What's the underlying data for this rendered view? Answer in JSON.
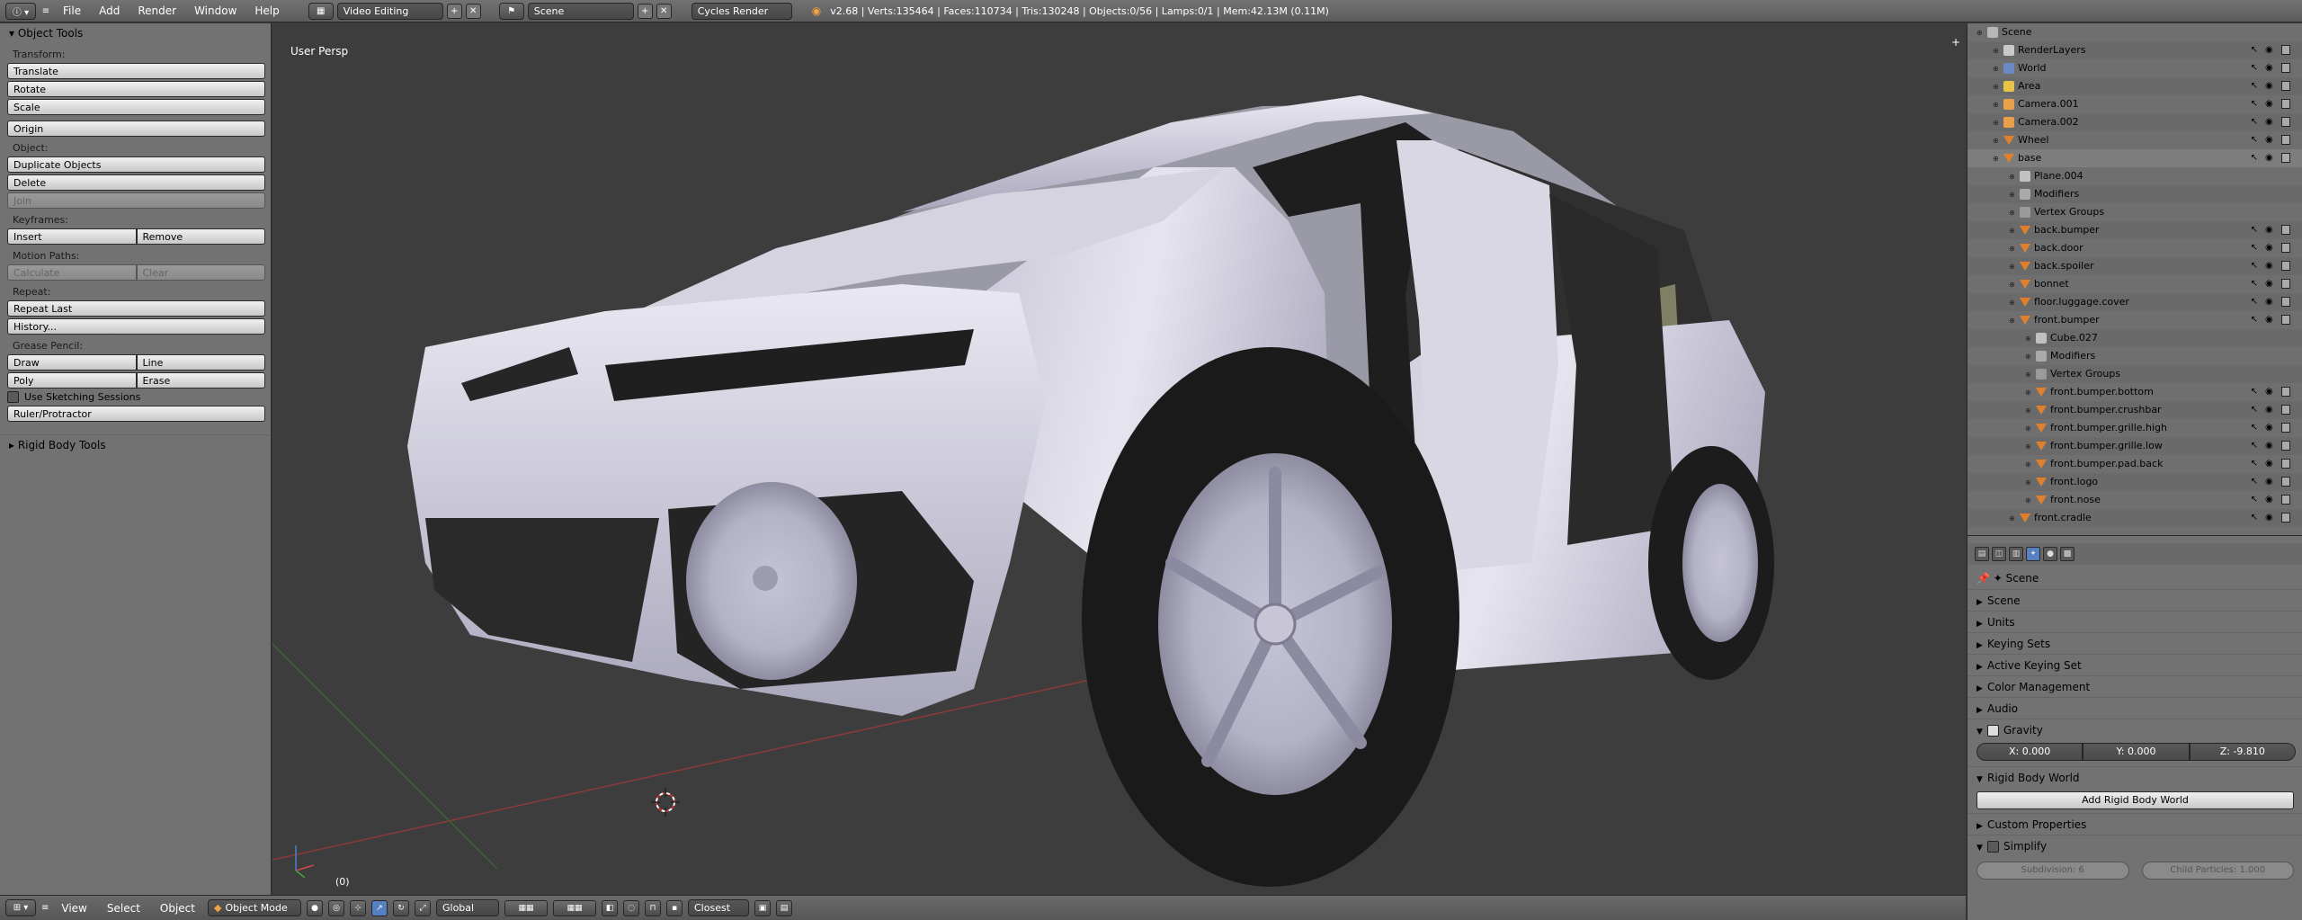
{
  "topbar": {
    "menus": [
      "File",
      "Add",
      "Render",
      "Window",
      "Help"
    ],
    "screen_layout": "Video Editing",
    "scene": "Scene",
    "render_engine": "Cycles Render",
    "stats": "v2.68 | Verts:135464 | Faces:110734 | Tris:130248 | Objects:0/56 | Lamps:0/1 | Mem:42.13M (0.11M)"
  },
  "tools": {
    "panel_title": "Object Tools",
    "transform_label": "Transform:",
    "translate": "Translate",
    "rotate": "Rotate",
    "scale": "Scale",
    "origin": "Origin",
    "object_label": "Object:",
    "duplicate": "Duplicate Objects",
    "delete": "Delete",
    "join": "Join",
    "keyframes_label": "Keyframes:",
    "insert": "Insert",
    "remove": "Remove",
    "motion_paths_label": "Motion Paths:",
    "calculate": "Calculate",
    "clear": "Clear",
    "repeat_label": "Repeat:",
    "repeat_last": "Repeat Last",
    "history": "History...",
    "grease_label": "Grease Pencil:",
    "draw": "Draw",
    "line": "Line",
    "poly": "Poly",
    "erase": "Erase",
    "sketching": "Use Sketching Sessions",
    "ruler": "Ruler/Protractor",
    "rigid_body_tools": "Rigid Body Tools"
  },
  "viewport": {
    "label": "User Persp",
    "frame": "(0)"
  },
  "outliner": {
    "rows": [
      {
        "label": "Scene",
        "indent": 0,
        "icon": "scene-icon"
      },
      {
        "label": "RenderLayers",
        "indent": 1,
        "icon": "renderlayers-icon"
      },
      {
        "label": "World",
        "indent": 1,
        "icon": "world-icon"
      },
      {
        "label": "Area",
        "indent": 1,
        "icon": "lamp-icon"
      },
      {
        "label": "Camera.001",
        "indent": 1,
        "icon": "camera-icon"
      },
      {
        "label": "Camera.002",
        "indent": 1,
        "icon": "camera-icon"
      },
      {
        "label": "Wheel",
        "indent": 1,
        "icon": "mesh-icon"
      },
      {
        "label": "base",
        "indent": 1,
        "icon": "mesh-icon"
      },
      {
        "label": "Plane.004",
        "indent": 2,
        "icon": "mesh-data-icon"
      },
      {
        "label": "Modifiers",
        "indent": 2,
        "icon": "wrench-icon"
      },
      {
        "label": "Vertex Groups",
        "indent": 2,
        "icon": "vertex-groups-icon"
      },
      {
        "label": "back.bumper",
        "indent": 2,
        "icon": "mesh-icon"
      },
      {
        "label": "back.door",
        "indent": 2,
        "icon": "mesh-icon"
      },
      {
        "label": "back.spoiler",
        "indent": 2,
        "icon": "mesh-icon"
      },
      {
        "label": "bonnet",
        "indent": 2,
        "icon": "mesh-icon"
      },
      {
        "label": "floor.luggage.cover",
        "indent": 2,
        "icon": "mesh-icon"
      },
      {
        "label": "front.bumper",
        "indent": 2,
        "icon": "mesh-icon"
      },
      {
        "label": "Cube.027",
        "indent": 3,
        "icon": "mesh-data-icon"
      },
      {
        "label": "Modifiers",
        "indent": 3,
        "icon": "wrench-icon"
      },
      {
        "label": "Vertex Groups",
        "indent": 3,
        "icon": "vertex-groups-icon"
      },
      {
        "label": "front.bumper.bottom",
        "indent": 3,
        "icon": "mesh-icon"
      },
      {
        "label": "front.bumper.crushbar",
        "indent": 3,
        "icon": "mesh-icon"
      },
      {
        "label": "front.bumper.grille.high",
        "indent": 3,
        "icon": "mesh-icon"
      },
      {
        "label": "front.bumper.grille.low",
        "indent": 3,
        "icon": "mesh-icon"
      },
      {
        "label": "front.bumper.pad.back",
        "indent": 3,
        "icon": "mesh-icon"
      },
      {
        "label": "front.logo",
        "indent": 3,
        "icon": "mesh-icon"
      },
      {
        "label": "front.nose",
        "indent": 3,
        "icon": "mesh-icon"
      },
      {
        "label": "front.cradle",
        "indent": 2,
        "icon": "mesh-icon"
      }
    ]
  },
  "properties": {
    "context": "Scene",
    "panels": {
      "scene": "Scene",
      "units": "Units",
      "keying_sets": "Keying Sets",
      "active_keying_set": "Active Keying Set",
      "color_management": "Color Management",
      "audio": "Audio",
      "gravity": "Gravity",
      "rigid_body_world": "Rigid Body World",
      "custom_properties": "Custom Properties",
      "simplify": "Simplify"
    },
    "gravity_x": "X: 0.000",
    "gravity_y": "Y: 0.000",
    "gravity_z": "Z: -9.810",
    "add_rigid_body_world": "Add Rigid Body World",
    "subdivision": "Subdivision: 6",
    "child_particles": "Child Particles: 1.000"
  },
  "bottombar": {
    "menus": [
      "View",
      "Select",
      "Object"
    ],
    "mode": "Object Mode",
    "orientation": "Global",
    "snap_target": "Closest"
  }
}
